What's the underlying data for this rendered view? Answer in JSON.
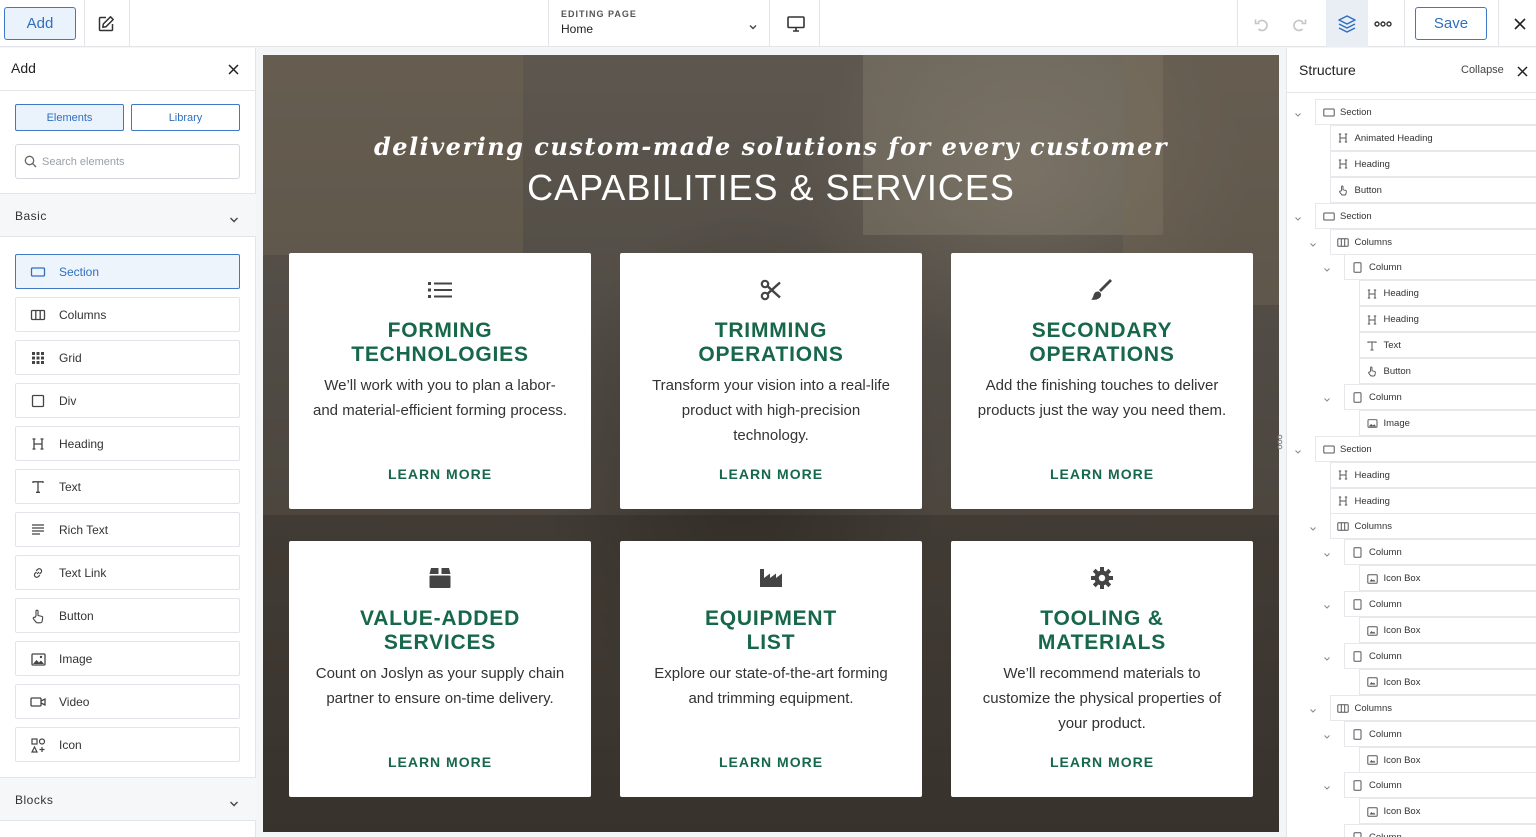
{
  "toolbar": {
    "add_label": "Add",
    "editing_label": "EDITING PAGE",
    "editing_value": "Home",
    "save_label": "Save"
  },
  "left_panel": {
    "title": "Add",
    "tabs": [
      "Elements",
      "Library"
    ],
    "search_placeholder": "Search elements",
    "basic_label": "Basic",
    "blocks_label": "Blocks",
    "elements": [
      {
        "label": "Section",
        "icon": "section-icon"
      },
      {
        "label": "Columns",
        "icon": "columns-icon"
      },
      {
        "label": "Grid",
        "icon": "grid-icon"
      },
      {
        "label": "Div",
        "icon": "div-icon"
      },
      {
        "label": "Heading",
        "icon": "heading-icon"
      },
      {
        "label": "Text",
        "icon": "text-icon"
      },
      {
        "label": "Rich Text",
        "icon": "rich-text-icon"
      },
      {
        "label": "Text Link",
        "icon": "link-icon"
      },
      {
        "label": "Button",
        "icon": "pointer-icon"
      },
      {
        "label": "Image",
        "icon": "image-icon"
      },
      {
        "label": "Video",
        "icon": "video-icon"
      },
      {
        "label": "Icon",
        "icon": "icon-element-icon"
      }
    ]
  },
  "canvas": {
    "tagline": "delivering custom-made solutions for every customer",
    "title": "CAPABILITIES & SERVICES",
    "cards": [
      {
        "icon": "list-icon",
        "title": "FORMING\nTECHNOLOGIES",
        "desc": "We’ll work with you to plan a labor- and material-efficient forming process.",
        "link": "LEARN MORE"
      },
      {
        "icon": "scissors-icon",
        "title": "TRIMMING\nOPERATIONS",
        "desc": "Transform your vision into a real-life product with high-precision technology.",
        "link": "LEARN MORE"
      },
      {
        "icon": "paint-brush-icon",
        "title": "SECONDARY\nOPERATIONS",
        "desc": "Add the finishing touches to deliver products just the way you need them.",
        "link": "LEARN MORE"
      },
      {
        "icon": "box-icon",
        "title": "VALUE-ADDED\nSERVICES",
        "desc": "Count on Joslyn as your supply chain partner to ensure on-time delivery.",
        "link": "LEARN MORE"
      },
      {
        "icon": "industry-icon",
        "title": "EQUIPMENT\nLIST",
        "desc": "Explore our state-of-the-art forming and trimming equipment.",
        "link": "LEARN MORE"
      },
      {
        "icon": "cog-icon",
        "title": "TOOLING &\nMATERIALS",
        "desc": "We’ll recommend materials to customize the physical properties of your product.",
        "link": "LEARN MORE"
      }
    ]
  },
  "structure": {
    "title": "Structure",
    "collapse_label": "Collapse",
    "tree": [
      {
        "label": "Section",
        "depth": 0,
        "icon": "section-icon",
        "caret": true
      },
      {
        "label": "Animated Heading",
        "depth": 1,
        "icon": "heading-icon",
        "caret": false
      },
      {
        "label": "Heading",
        "depth": 1,
        "icon": "heading-icon",
        "caret": false
      },
      {
        "label": "Button",
        "depth": 1,
        "icon": "pointer-icon",
        "caret": false
      },
      {
        "label": "Section",
        "depth": 0,
        "icon": "section-icon",
        "caret": true
      },
      {
        "label": "Columns",
        "depth": 1,
        "icon": "columns-icon",
        "caret": true
      },
      {
        "label": "Column",
        "depth": 2,
        "icon": "column-icon",
        "caret": true
      },
      {
        "label": "Heading",
        "depth": 3,
        "icon": "heading-icon",
        "caret": false
      },
      {
        "label": "Heading",
        "depth": 3,
        "icon": "heading-icon",
        "caret": false
      },
      {
        "label": "Text",
        "depth": 3,
        "icon": "text-icon",
        "caret": false
      },
      {
        "label": "Button",
        "depth": 3,
        "icon": "pointer-icon",
        "caret": false
      },
      {
        "label": "Column",
        "depth": 2,
        "icon": "column-icon",
        "caret": true
      },
      {
        "label": "Image",
        "depth": 3,
        "icon": "image-icon",
        "caret": false
      },
      {
        "label": "Section",
        "depth": 0,
        "icon": "section-icon",
        "caret": true
      },
      {
        "label": "Heading",
        "depth": 1,
        "icon": "heading-icon",
        "caret": false
      },
      {
        "label": "Heading",
        "depth": 1,
        "icon": "heading-icon",
        "caret": false
      },
      {
        "label": "Columns",
        "depth": 1,
        "icon": "columns-icon",
        "caret": true
      },
      {
        "label": "Column",
        "depth": 2,
        "icon": "column-icon",
        "caret": true
      },
      {
        "label": "Icon Box",
        "depth": 3,
        "icon": "icon-box-icon",
        "caret": false
      },
      {
        "label": "Column",
        "depth": 2,
        "icon": "column-icon",
        "caret": true
      },
      {
        "label": "Icon Box",
        "depth": 3,
        "icon": "icon-box-icon",
        "caret": false
      },
      {
        "label": "Column",
        "depth": 2,
        "icon": "column-icon",
        "caret": true
      },
      {
        "label": "Icon Box",
        "depth": 3,
        "icon": "icon-box-icon",
        "caret": false
      },
      {
        "label": "Columns",
        "depth": 1,
        "icon": "columns-icon",
        "caret": true
      },
      {
        "label": "Column",
        "depth": 2,
        "icon": "column-icon",
        "caret": true
      },
      {
        "label": "Icon Box",
        "depth": 3,
        "icon": "icon-box-icon",
        "caret": false
      },
      {
        "label": "Column",
        "depth": 2,
        "icon": "column-icon",
        "caret": true
      },
      {
        "label": "Icon Box",
        "depth": 3,
        "icon": "icon-box-icon",
        "caret": false
      },
      {
        "label": "Column",
        "depth": 2,
        "icon": "column-icon",
        "caret": true
      }
    ]
  },
  "colors": {
    "accent": "#3d79c7",
    "brand_green": "#17674a"
  }
}
